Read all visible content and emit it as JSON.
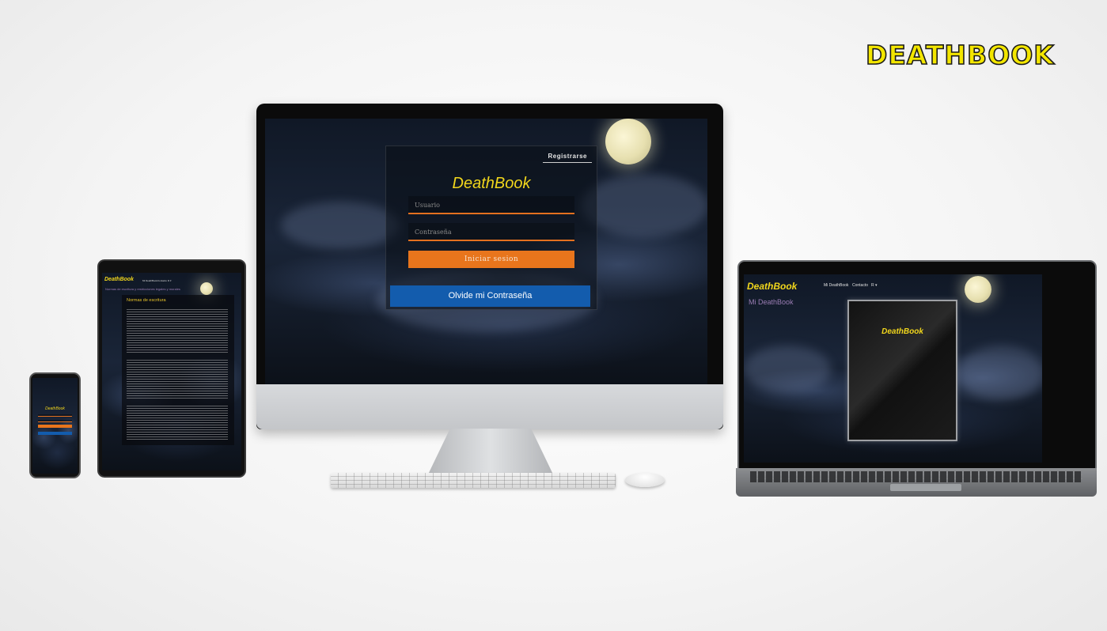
{
  "brand_banner": "DEATHBOOK",
  "desktop": {
    "register_button": "Registrarse",
    "title": "DeathBook",
    "username_placeholder": "Usuario",
    "password_placeholder": "Contraseña",
    "login_button": "Iniciar sesion",
    "forgot_button": "Olvide mi Contraseña"
  },
  "laptop": {
    "brand": "DeathBook",
    "nav": [
      "Mi DeathBook",
      "Contacto",
      "R ▾"
    ],
    "subtitle": "Mi DeathBook",
    "book_title": "DeathBook"
  },
  "tablet": {
    "brand": "DeathBook",
    "nav": [
      "Mi DeathBook",
      "Contacto",
      "R ▾"
    ],
    "subtitle": "Normas de escritura y restricciones legales y morales",
    "doc_heading": "Normas de escritura"
  },
  "phone": {
    "brand": "DeathBook"
  },
  "colors": {
    "accent_yellow": "#f1d61c",
    "accent_orange": "#e8751c",
    "button_blue": "#135cad",
    "subtitle_purple": "#9b7db4"
  }
}
